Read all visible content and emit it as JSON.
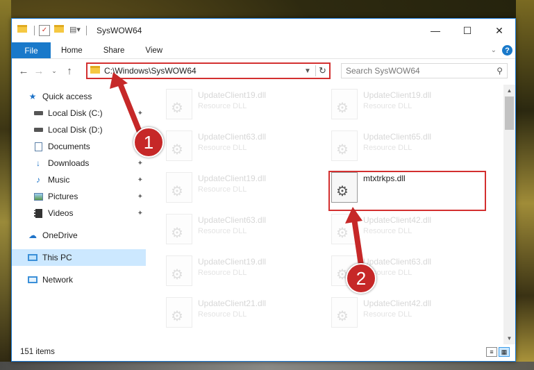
{
  "window": {
    "title": "SysWOW64",
    "caption_buttons": [
      "minimize-icon",
      "maximize-icon",
      "close-icon"
    ]
  },
  "ribbon": {
    "tabs": [
      "File",
      "Home",
      "Share",
      "View"
    ],
    "help_label": "?"
  },
  "navigation": {
    "address": "C:\\Windows\\SysWOW64",
    "search_placeholder": "Search SysWOW64"
  },
  "sidebar": {
    "items": [
      {
        "label": "Quick access",
        "icon": "star-icon",
        "pinned": false
      },
      {
        "label": "Local Disk (C:)",
        "icon": "drive-icon",
        "pinned": true
      },
      {
        "label": "Local Disk (D:)",
        "icon": "drive-icon",
        "pinned": true
      },
      {
        "label": "Documents",
        "icon": "documents-icon",
        "pinned": true
      },
      {
        "label": "Downloads",
        "icon": "download-icon",
        "pinned": true
      },
      {
        "label": "Music",
        "icon": "music-icon",
        "pinned": true
      },
      {
        "label": "Pictures",
        "icon": "pictures-icon",
        "pinned": true
      },
      {
        "label": "Videos",
        "icon": "videos-icon",
        "pinned": true
      },
      {
        "label": "OneDrive",
        "icon": "cloud-icon",
        "pinned": false
      },
      {
        "label": "This PC",
        "icon": "computer-icon",
        "pinned": false
      },
      {
        "label": "Network",
        "icon": "network-icon",
        "pinned": false
      }
    ]
  },
  "files": [
    {
      "name": "UpdateClient19.dll",
      "type": "Resource DLL"
    },
    {
      "name": "UpdateClient19.dll",
      "type": "Resource DLL"
    },
    {
      "name": "UpdateClient63.dll",
      "type": "Resource DLL"
    },
    {
      "name": "UpdateClient65.dll",
      "type": "Resource DLL"
    },
    {
      "name": "UpdateClient19.dll",
      "type": "Resource DLL"
    },
    {
      "name": "mtxtrkps.dll",
      "type": ""
    },
    {
      "name": "UpdateClient63.dll",
      "type": "Resource DLL"
    },
    {
      "name": "UpdateClient42.dll",
      "type": "Resource DLL"
    },
    {
      "name": "UpdateClient19.dll",
      "type": "Resource DLL"
    },
    {
      "name": "UpdateClient63.dll",
      "type": "Resource DLL"
    },
    {
      "name": "UpdateClient21.dll",
      "type": "Resource DLL"
    },
    {
      "name": "UpdateClient42.dll",
      "type": "Resource DLL"
    }
  ],
  "status": {
    "item_count": "151 items"
  },
  "annotations": {
    "marker_1": "1",
    "marker_2": "2",
    "color": "#c62828"
  }
}
